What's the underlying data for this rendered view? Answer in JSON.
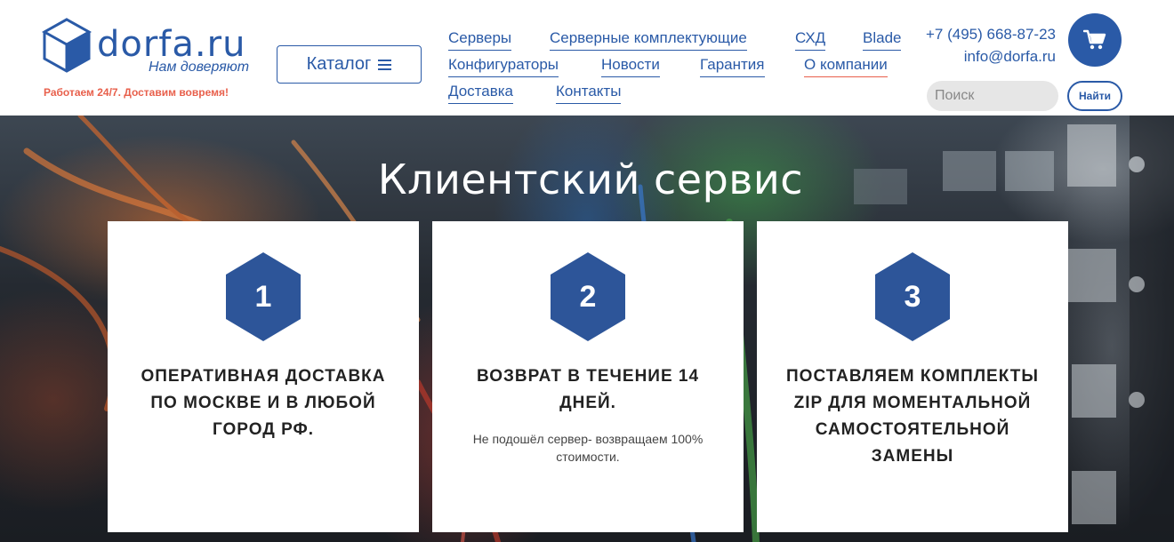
{
  "header": {
    "logo_text": "dorfa.ru",
    "logo_slogan": "Нам доверяют",
    "work_hours": "Работаем 24/7. Доставим вовремя!",
    "catalog_label": "Каталог",
    "phone": "+7 (495) 668-87-23",
    "email": "info@dorfa.ru",
    "search": {
      "placeholder": "Поиск",
      "button_label": "Найти"
    }
  },
  "nav": {
    "items": [
      {
        "label": "Серверы"
      },
      {
        "label": "Серверные комплектующие"
      },
      {
        "label": "СХД"
      },
      {
        "label": "Blade"
      },
      {
        "label": "Конфигураторы"
      },
      {
        "label": "Новости"
      },
      {
        "label": "Гарантия"
      },
      {
        "label": "О компании",
        "active": true
      },
      {
        "label": "Доставка"
      },
      {
        "label": "Контакты"
      }
    ]
  },
  "hero": {
    "title": "Клиентский сервис",
    "cards": [
      {
        "number": "1",
        "title": "Оперативная доставка по Москве и в любой город РФ.",
        "description": ""
      },
      {
        "number": "2",
        "title": "Возврат в течение 14 дней.",
        "description": "Не подошёл сервер- возвращаем 100% стоимости."
      },
      {
        "number": "3",
        "title": "Поставляем комплекты ZIP для моментальной самостоятельной замены",
        "description": ""
      }
    ]
  },
  "colors": {
    "brand_blue": "#2a5aa7",
    "accent_orange": "#e8604c",
    "hexagon": "#2d5599"
  },
  "icons": {
    "logo": "cube-logo-icon",
    "cart": "shopping-cart-icon",
    "catalog": "hamburger-menu-icon"
  }
}
